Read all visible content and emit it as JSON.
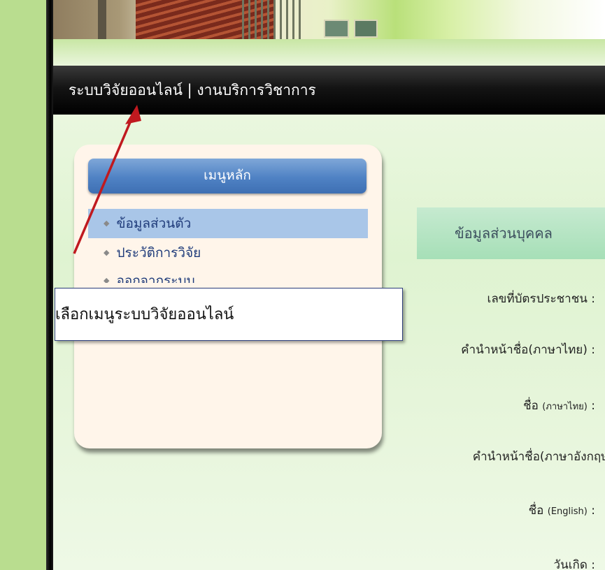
{
  "topbar": {
    "title": "ระบบวิจัยออนไลน์  | งานบริการวิชาการ"
  },
  "menu": {
    "header": "เมนูหลัก",
    "items": [
      {
        "label": "ข้อมูลส่วนตัว",
        "active": true
      },
      {
        "label": "ประวัติการวิจัย",
        "active": false
      },
      {
        "label": "ออกจากระบบ",
        "active": false
      }
    ]
  },
  "profile": {
    "section_title": "ข้อมูลส่วนบุคคล",
    "fields": [
      {
        "label": "เลขที่บัตรประชาชน :"
      },
      {
        "label": "คำนำหน้าชื่อ(ภาษาไทย) :"
      },
      {
        "label": "ชื่อ",
        "sub": "(ภาษาไทย)",
        "suffix": " :"
      },
      {
        "label": "คำนำหน้าชื่อ(ภาษาอังกฤษ)"
      },
      {
        "label": "ชื่อ",
        "sub": "(English)",
        "suffix": " :"
      },
      {
        "label": "วันเกิด :"
      }
    ]
  },
  "annotation": {
    "callout_text": "เลือกเมนูระบบวิจัยออนไลน์",
    "arrow_color": "#c0191f"
  },
  "colors": {
    "menu_active": "#a9c6e8",
    "menu_header": "#4f82c4",
    "section_header": "#b6e4c3",
    "topbar": "#000000"
  }
}
